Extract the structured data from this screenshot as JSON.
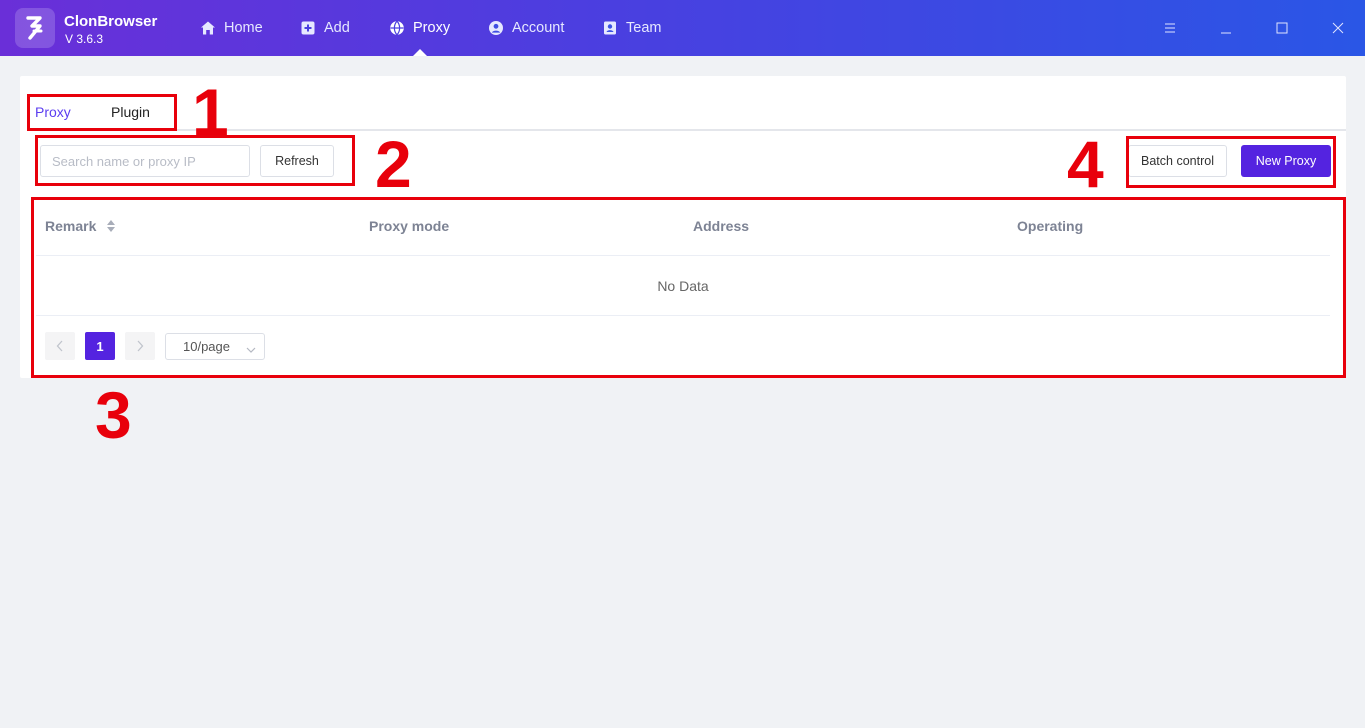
{
  "app": {
    "name": "ClonBrowser",
    "version": "V 3.6.3"
  },
  "nav": [
    {
      "label": "Home",
      "icon": "home-icon"
    },
    {
      "label": "Add",
      "icon": "plus-square-icon"
    },
    {
      "label": "Proxy",
      "icon": "globe-icon",
      "active": true
    },
    {
      "label": "Account",
      "icon": "user-circle-icon"
    },
    {
      "label": "Team",
      "icon": "contact-card-icon"
    }
  ],
  "window_controls": [
    "menu-icon",
    "minimize-icon",
    "maximize-icon",
    "close-icon"
  ],
  "tabs": [
    {
      "label": "Proxy",
      "active": true
    },
    {
      "label": "Plugin",
      "active": false
    }
  ],
  "toolbar": {
    "search_placeholder": "Search name or proxy IP",
    "refresh_label": "Refresh",
    "batch_label": "Batch control",
    "new_proxy_label": "New Proxy"
  },
  "table": {
    "columns": [
      "Remark",
      "Proxy mode",
      "Address",
      "Operating"
    ],
    "empty_text": "No Data"
  },
  "pagination": {
    "current_page": "1",
    "page_size": "10/page"
  },
  "annotations": [
    "1",
    "2",
    "3",
    "4"
  ],
  "colors": {
    "header_gradient_start": "#6a2fd8",
    "header_gradient_end": "#2a56e6",
    "accent": "#5423e0",
    "annotation": "#e8000b"
  }
}
